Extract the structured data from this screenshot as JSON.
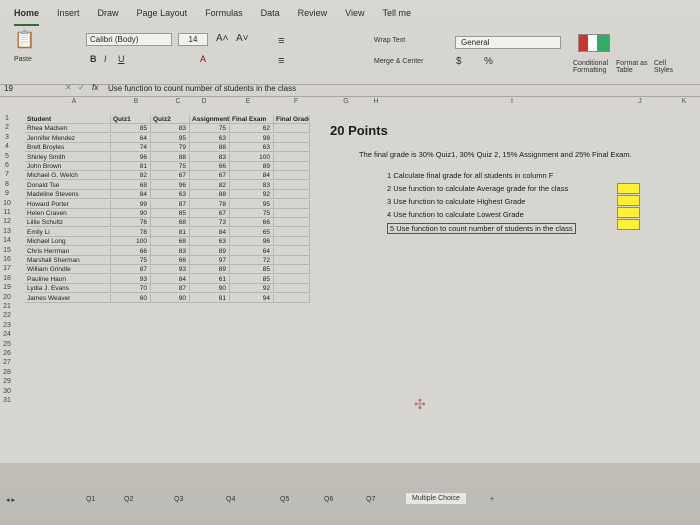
{
  "tabs": [
    "Home",
    "Insert",
    "Draw",
    "Page Layout",
    "Formulas",
    "Data",
    "Review",
    "View",
    "Tell me"
  ],
  "ribbon": {
    "paste": "Paste",
    "font_name": "Calibri (Body)",
    "font_size": "14",
    "wrap_text": "Wrap Text",
    "merge_center": "Merge & Center",
    "number_format": "General",
    "conditional_formatting": "Conditional Formatting",
    "format_as_table": "Format as Table",
    "cell_styles": "Cell Styles",
    "dollar": "$",
    "percent": "%"
  },
  "formula_bar": {
    "name_box": "19",
    "fx": "fx",
    "content": "Use function to count number of students in the class"
  },
  "columns": [
    "A",
    "B",
    "C",
    "D",
    "E",
    "F",
    "G",
    "H",
    "I",
    "J",
    "K"
  ],
  "table": {
    "headers": [
      "Student",
      "Quiz1",
      "Quiz2",
      "Assignment",
      "Final Exam",
      "Final Grade"
    ],
    "rows": [
      [
        "Rhea Madsen",
        "85",
        "83",
        "75",
        "62"
      ],
      [
        "Jennifer Mendez",
        "64",
        "95",
        "63",
        "98"
      ],
      [
        "Brett Broyles",
        "74",
        "79",
        "88",
        "63"
      ],
      [
        "Shirley Smith",
        "96",
        "88",
        "83",
        "100"
      ],
      [
        "John Brown",
        "81",
        "75",
        "66",
        "89"
      ],
      [
        "Michael G. Welch",
        "82",
        "67",
        "67",
        "84"
      ],
      [
        "Donald Tse",
        "68",
        "96",
        "82",
        "83"
      ],
      [
        "Madeline Stevens",
        "84",
        "63",
        "88",
        "92"
      ],
      [
        "Howard Porter",
        "99",
        "87",
        "78",
        "95"
      ],
      [
        "Helen Craven",
        "90",
        "85",
        "67",
        "75"
      ],
      [
        "Lillie Schultz",
        "76",
        "68",
        "73",
        "66"
      ],
      [
        "Emily Li",
        "78",
        "81",
        "84",
        "65"
      ],
      [
        "Michael Long",
        "100",
        "68",
        "63",
        "96"
      ],
      [
        "Chris Herrman",
        "66",
        "83",
        "89",
        "64"
      ],
      [
        "Marshall Sherman",
        "75",
        "66",
        "97",
        "72"
      ],
      [
        "William Grindle",
        "87",
        "93",
        "89",
        "85"
      ],
      [
        "Pauline Haun",
        "93",
        "84",
        "61",
        "85"
      ],
      [
        "Lydia J. Evans",
        "70",
        "87",
        "90",
        "92"
      ],
      [
        "James Weaver",
        "60",
        "90",
        "81",
        "94"
      ]
    ]
  },
  "points_label": "20 Points",
  "instructions": "The final grade is 30% Quiz1, 30% Quiz 2, 15% Assignment and 25% Final Exam.",
  "tasks": [
    "1 Calculate final grade for all students in column F",
    "2 Use function to calculate Average grade for the class",
    "3 Use function to calculate Highest Grade",
    "4 Use function to calculate Lowest Grade",
    "5 Use function to count number of students in the class"
  ],
  "sheets": [
    "Q1",
    "Q2",
    "Q3",
    "Q4",
    "Q5",
    "Q6",
    "Q7",
    "Multiple Choice",
    "+"
  ],
  "colors": {
    "highlight_yellow": "#ffef36",
    "active_tab": "#2c6e2f"
  }
}
